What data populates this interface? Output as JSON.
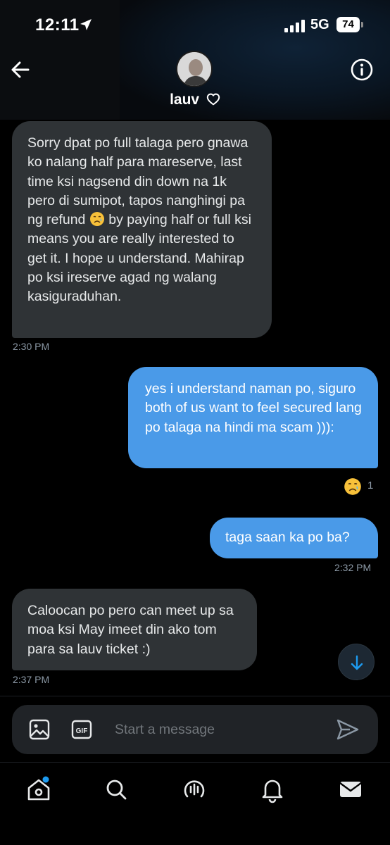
{
  "status_bar": {
    "time": "12:11",
    "network": "5G",
    "battery": "74"
  },
  "header": {
    "contact_name": "lauv",
    "icons": [
      "back-arrow-icon",
      "heart-icon",
      "info-icon"
    ]
  },
  "messages": [
    {
      "direction": "incoming",
      "text_before_emoji": "Sorry dpat po full talaga pero gnawa ko nalang half para mareserve, last time ksi nagsend din down na 1k pero di sumipot, tapos nanghingi pa ng refund",
      "emoji": "crying-face",
      "text_after_emoji": "by paying half or full ksi means you are really interested to get it. I hope u understand. Mahirap po ksi ireserve agad ng walang kasiguraduhan.",
      "time": "2:30 PM"
    },
    {
      "direction": "outgoing",
      "text": "yes i understand naman po, siguro both of us want to feel secured lang po talaga na hindi ma scam ))):",
      "reaction": {
        "emoji": "crying-face",
        "count": "1"
      }
    },
    {
      "direction": "outgoing",
      "text": "taga saan ka po ba?",
      "time": "2:32 PM"
    },
    {
      "direction": "incoming",
      "text": "Caloocan po pero can meet up sa moa ksi May imeet din ako tom para sa lauv ticket :)",
      "time": "2:37 PM"
    }
  ],
  "composer": {
    "placeholder": "Start a message",
    "gif_label": "GIF"
  },
  "bottom_nav": {
    "items": [
      "home-icon",
      "search-icon",
      "spaces-icon",
      "notifications-icon",
      "messages-icon"
    ],
    "home_has_badge": true
  },
  "colors": {
    "accent": "#1d9bf0",
    "outgoing_bubble": "#4a9ae8",
    "incoming_bubble": "#2f3336",
    "background": "#000000"
  }
}
